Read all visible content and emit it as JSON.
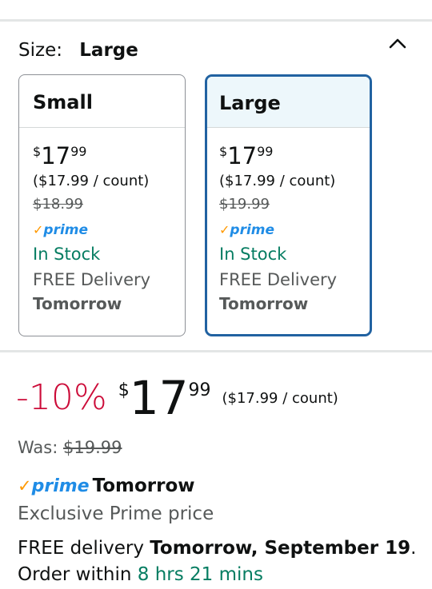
{
  "size_selector": {
    "label": "Size:",
    "selected": "Large"
  },
  "options": [
    {
      "name": "Small",
      "price_symbol": "$",
      "price_whole": "17",
      "price_fraction": "99",
      "unit_price": "($17.99 / count)",
      "list_price": "$18.99",
      "prime_label": "prime",
      "stock": "In Stock",
      "delivery": "FREE Delivery",
      "delivery_day": "Tomorrow"
    },
    {
      "name": "Large",
      "price_symbol": "$",
      "price_whole": "17",
      "price_fraction": "99",
      "unit_price": "($17.99 / count)",
      "list_price": "$19.99",
      "prime_label": "prime",
      "stock": "In Stock",
      "delivery": "FREE Delivery",
      "delivery_day": "Tomorrow"
    }
  ],
  "main_price": {
    "discount": "-10%",
    "symbol": "$",
    "whole": "17",
    "fraction": "99",
    "unit_price": "($17.99 / count)"
  },
  "was": {
    "label": "Was:",
    "price": "$19.99"
  },
  "prime_delivery": {
    "prime_label": "prime",
    "day": "Tomorrow",
    "note": "Exclusive Prime price"
  },
  "free_delivery": {
    "prefix": "FREE delivery ",
    "date": "Tomorrow, September 19",
    "middle": ". Order within ",
    "countdown": "8 hrs 21 mins"
  },
  "colors": {
    "accent_blue": "#2162a1",
    "prime_blue": "#1f8ce6",
    "prime_check": "#ff9900",
    "in_stock_green": "#067d62",
    "discount_red": "#cc0c39"
  }
}
